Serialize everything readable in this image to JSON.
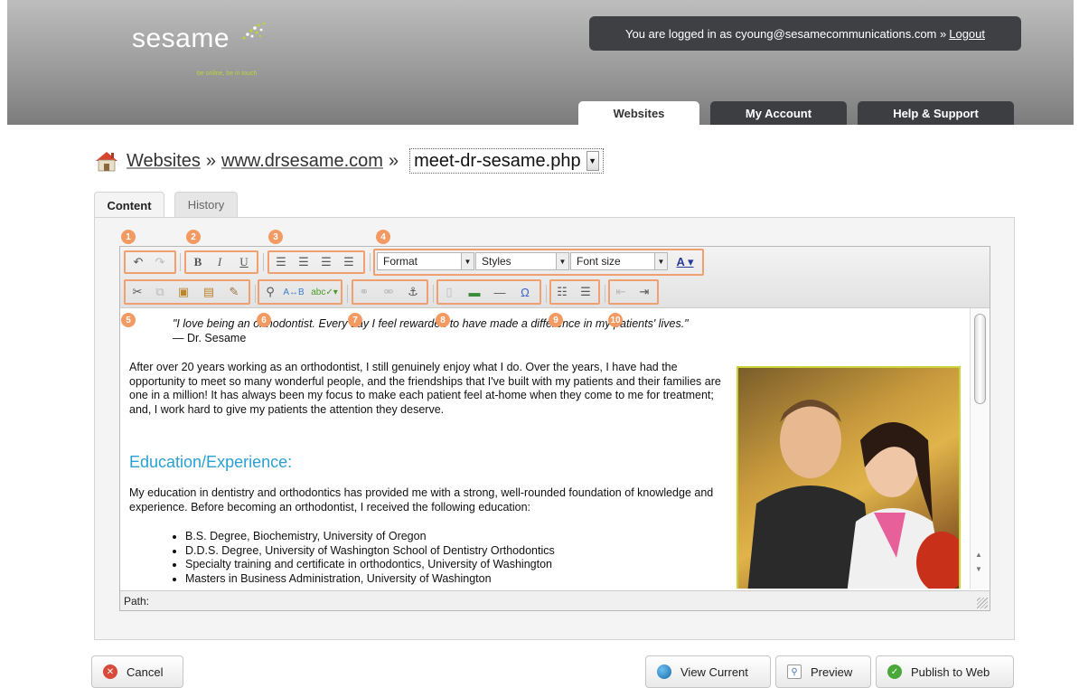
{
  "header": {
    "logo_text": "sesame",
    "logo_tagline": "be online, be in touch",
    "logged_in_text": "You are logged in as cyoung@sesamecommunications.com »",
    "logout_label": "Logout",
    "tabs": [
      {
        "label": "Websites",
        "active": true
      },
      {
        "label": "My Account",
        "active": false
      },
      {
        "label": "Help & Support",
        "active": false
      }
    ]
  },
  "breadcrumb": {
    "root": "Websites",
    "separator": "»",
    "site": "www.drsesame.com",
    "page_selected": "meet-dr-sesame.php"
  },
  "content_tabs": [
    {
      "label": "Content",
      "active": true
    },
    {
      "label": "History",
      "active": false
    }
  ],
  "toolbar": {
    "format_label": "Format",
    "styles_label": "Styles",
    "fontsize_label": "Font size",
    "callouts": [
      "1",
      "2",
      "3",
      "4",
      "5",
      "6",
      "7",
      "8",
      "9",
      "10"
    ]
  },
  "document": {
    "quote": "\"I love being an orthodontist. Every day I feel rewarded to have made a difference in my patients' lives.\"",
    "quote_author": "— Dr. Sesame",
    "paragraph1": "After over 20 years working as an orthodontist, I still genuinely enjoy what I do. Over the years, I have had the opportunity to meet so many wonderful people, and the friendships that I've built with my patients and their families are one in a million! It has always been my focus to make each patient feel at-home when they come to me for treatment; and, I work hard to give my patients the attention they deserve.",
    "heading": "Education/Experience:",
    "paragraph2": "My education in dentistry and orthodontics has provided me with a strong, well-rounded foundation of knowledge and experience. Before becoming an orthodontist, I received the following education:",
    "education": [
      "B.S. Degree, Biochemistry, University of Oregon",
      "D.D.S. Degree, University of Washington School of Dentistry Orthodontics",
      "Specialty training and certificate in orthodontics, University of Washington",
      "Masters in Business Administration, University of Washington"
    ]
  },
  "path_label": "Path:",
  "buttons": {
    "cancel": "Cancel",
    "view_current": "View Current",
    "preview": "Preview",
    "publish": "Publish to Web"
  },
  "colors": {
    "heading": "#2aa0d2",
    "callout": "#f39a62",
    "logo_accent": "#b7d43a"
  }
}
